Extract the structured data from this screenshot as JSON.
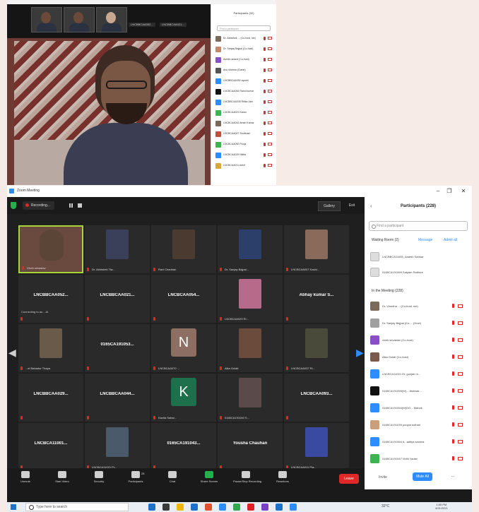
{
  "top_window": {
    "speaker_label": "",
    "participants_title": "Participants (32)",
    "search_placeholder": "Find a participant",
    "thumb_names": [
      "LNCBBCAA052...",
      "LNCBBCAA021..."
    ],
    "participants": [
      {
        "name": "Dr. Abhishek ... (Co-host, me)",
        "color": "#7a6a5a"
      },
      {
        "name": "Dr. Sanjay Bajpai (Co-host)",
        "color": "#c08a6a"
      },
      {
        "name": "Ashish anand (Co-host)",
        "color": "#8a4fc6"
      },
      {
        "name": "Anu sharma (Guest)",
        "color": "#555"
      },
      {
        "name": "LNCBBCAA052 ayushi",
        "color": "#2d8cff"
      },
      {
        "name": "LNCBCAA054 Rahul kumar",
        "color": "#111"
      },
      {
        "name": "LNCBBCAA035 Ritika Jain",
        "color": "#2d8cff"
      },
      {
        "name": "LNCBCAA021 Karan",
        "color": "#3fb34f"
      },
      {
        "name": "LNCBCAA044 Aman Kumar",
        "color": "#7a6a5a"
      },
      {
        "name": "LNCBCAA047 Shubham",
        "color": "#c0503f"
      },
      {
        "name": "LNCBCAA050 Pooja",
        "color": "#3fb34f"
      },
      {
        "name": "LNCBCAA029 Nikita",
        "color": "#2d8cff"
      },
      {
        "name": "LNCBCAA011 Ankit",
        "color": "#d8a83a"
      }
    ]
  },
  "zoom": {
    "app_title": "Zoom Meeting",
    "recording_label": "Recording...",
    "view_label": "Gallery",
    "exit_label": "Exit",
    "nav_left": "1/2",
    "nav_right": "1/2",
    "tiles": [
      {
        "center": "",
        "name": "Vivek srivastav",
        "kind": "video",
        "active": true,
        "color": "#5b4536"
      },
      {
        "center": "",
        "name": "Dr. Abhishek Tiw...",
        "kind": "photo",
        "color": "#3a3f5a"
      },
      {
        "center": "",
        "name": "Ravi Chauhan",
        "kind": "photo",
        "color": "#4a3a30"
      },
      {
        "center": "",
        "name": "Dr. Sanjay Bajpai...",
        "kind": "photo",
        "color": "#2c3f6a"
      },
      {
        "center": "",
        "name": "LNCBCAA007 Kashi...",
        "kind": "photo",
        "color": "#8a6a5a"
      },
      {
        "center": "LNCBBCAA052...",
        "name": "Connecting to au... Al",
        "kind": "text",
        "conn": true
      },
      {
        "center": "LNCBBCAA021...",
        "name": "",
        "kind": "text"
      },
      {
        "center": "LNCBCAA054...",
        "name": "",
        "kind": "text"
      },
      {
        "center": "",
        "name": "LNCBCAA029 Ri...",
        "kind": "photo",
        "color": "#b76a8a"
      },
      {
        "center": "Abhay kumar S...",
        "name": "",
        "kind": "text"
      },
      {
        "center": "",
        "name": "...el Bahadur Thapa",
        "kind": "photo",
        "color": "#6a5a4a"
      },
      {
        "center": "0165CA191053...",
        "name": "",
        "kind": "text"
      },
      {
        "center": "",
        "name": "LNCBCAA070 ...",
        "kind": "letter",
        "letter": "N",
        "color": "#8d6e63"
      },
      {
        "center": "",
        "name": "Alka Gulati",
        "kind": "photo",
        "color": "#6b4b3b"
      },
      {
        "center": "",
        "name": "LNCBCAA037 Ri...",
        "kind": "photo",
        "color": "#4a4a3a"
      },
      {
        "center": "LNCBBCAA029...",
        "name": "",
        "kind": "text"
      },
      {
        "center": "LNCBBCAA044...",
        "name": "",
        "kind": "text"
      },
      {
        "center": "",
        "name": "Kavita Sahar...",
        "kind": "letter",
        "letter": "K",
        "color": "#1e6f4c"
      },
      {
        "center": "",
        "name": "0165CA191040 S...",
        "kind": "photo",
        "color": "#5a4a4a"
      },
      {
        "center": "LNCBCAA093...",
        "name": "",
        "kind": "text"
      },
      {
        "center": "LNCBCA11001...",
        "name": "",
        "kind": "text"
      },
      {
        "center": "",
        "name": "LNCBCA11021 Pr...",
        "kind": "photo",
        "color": "#4a5a6a"
      },
      {
        "center": "0165CA191043...",
        "name": "",
        "kind": "text"
      },
      {
        "center": "Yousha Chauhan",
        "name": "",
        "kind": "text"
      },
      {
        "center": "",
        "name": "LNCBCAA011 Pia...",
        "kind": "photo",
        "color": "#3a4aa0"
      }
    ],
    "toolbar": [
      {
        "label": "Unmute",
        "icon": "microphone-icon"
      },
      {
        "label": "Start Video",
        "icon": "video-camera-icon"
      },
      {
        "label": "Security",
        "icon": "shield-icon"
      },
      {
        "label": "Participants",
        "icon": "participants-icon",
        "count": "28"
      },
      {
        "label": "Chat",
        "icon": "chat-icon"
      },
      {
        "label": "Share Screen",
        "icon": "share-screen-icon"
      },
      {
        "label": "Pause/Stop Recording",
        "icon": "recording-icon"
      },
      {
        "label": "Reactions",
        "icon": "reactions-icon"
      }
    ],
    "leave_label": "Leave",
    "participants_panel": {
      "title": "Participants (228)",
      "search_placeholder": "Find a participant",
      "waiting_header": "Waiting Room (2)",
      "message_label": "Message",
      "admit_all_label": "Admit all",
      "waiting": [
        {
          "name": "LNCBBCA11055_Adarsh Sankar",
          "color": "#ddd"
        },
        {
          "name": "0165CA191069 Satyam Rathore",
          "color": "#ddd"
        }
      ],
      "in_meeting_header": "In the Meeting (228)",
      "members": [
        {
          "name": "Dr. Vinodha ... (Co-host, me)",
          "color": "#7a6a5a"
        },
        {
          "name": "Dr. Sanjay Bajpai (Co-... (Host)",
          "color": "#a0a0a0"
        },
        {
          "name": "vivek srivastav (Co-host)",
          "color": "#8a4fc6"
        },
        {
          "name": "Alka Gulati (Co-host)",
          "color": "#7a5a4a"
        },
        {
          "name": "LNCBCA11001 Dr. gunjan m...",
          "color": "#2d8cff"
        },
        {
          "name": "0165CA191059(W)... Aishwar...",
          "color": "#111"
        },
        {
          "name": "0165CA191054(W)DG... Mahak",
          "color": "#2d8cff"
        },
        {
          "name": "0165CA191039 poojan kothari",
          "color": "#c9a07a"
        },
        {
          "name": "0165CA191064 A...aditya saxena",
          "color": "#2d8cff"
        },
        {
          "name": "0165CA191047 Vidhi Yadav",
          "color": "#3fb34f"
        }
      ],
      "invite_label": "Invite",
      "mute_all_label": "Mute All",
      "more_label": "..."
    }
  },
  "taskbar": {
    "search_placeholder": "Type here to search",
    "temperature": "32°C",
    "time": "1:05 PM",
    "date": "4/21/2021",
    "apps": [
      "#1a73c9",
      "#3a3a3a",
      "#f2b705",
      "#1a73c9",
      "#e0502a",
      "#2d8cff",
      "#2fa84f",
      "#e21f26",
      "#7a3fc6",
      "#1a73c9",
      "#2d8cff"
    ]
  }
}
